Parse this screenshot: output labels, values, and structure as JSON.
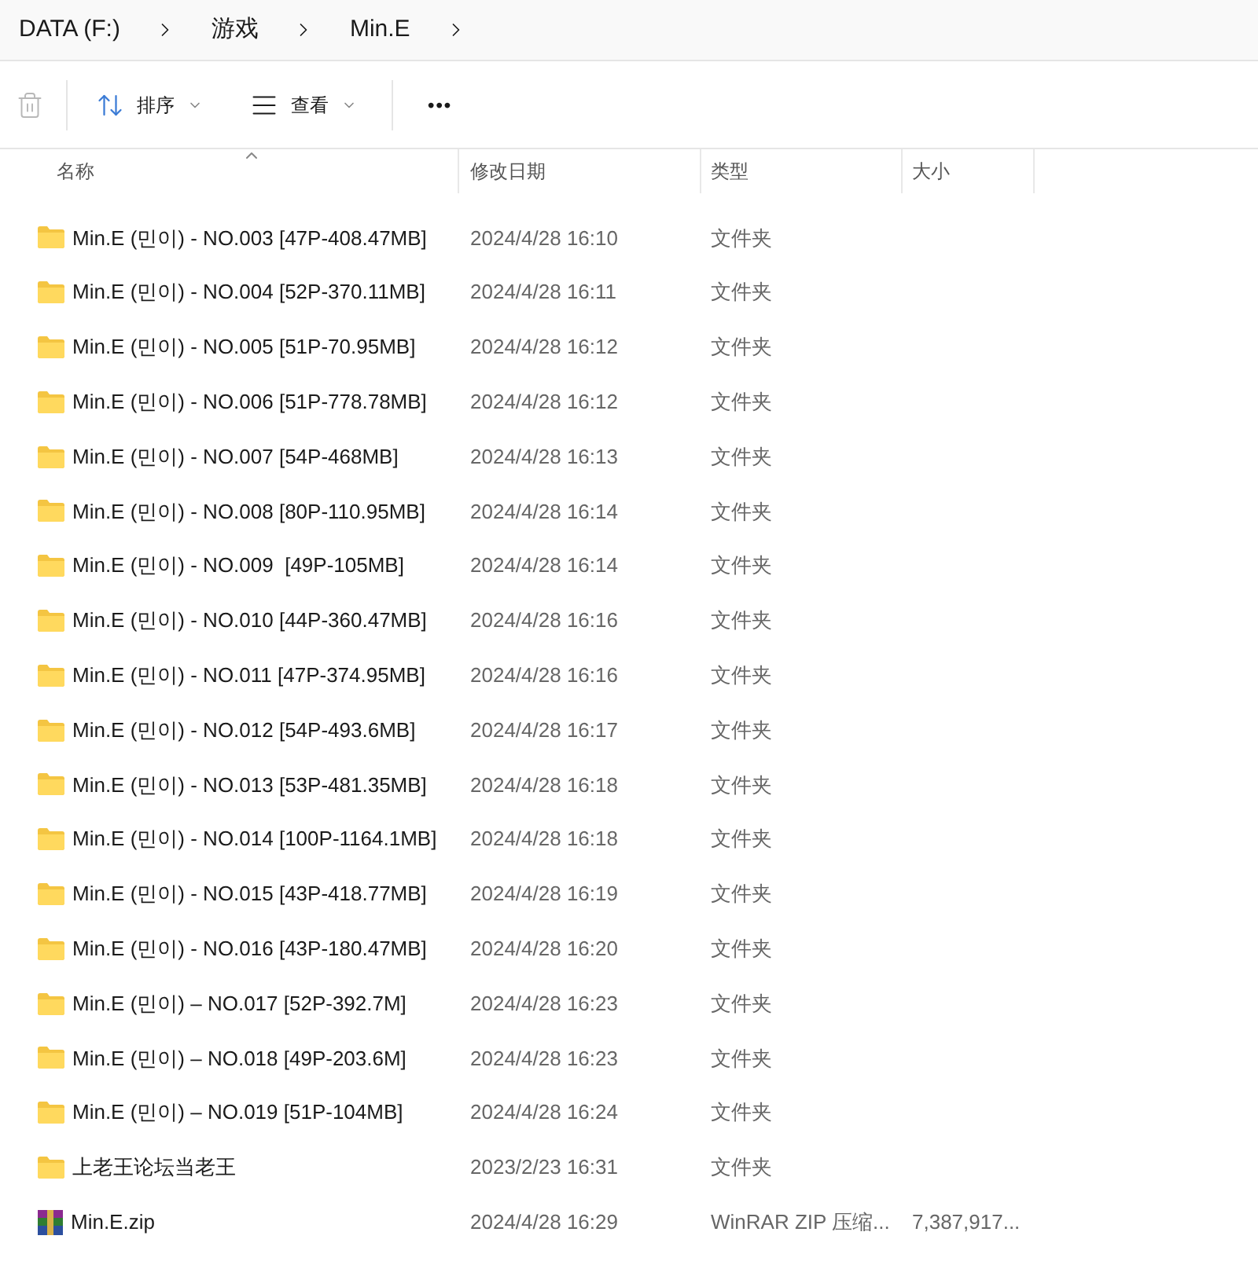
{
  "breadcrumb": [
    "DATA (F:)",
    "游戏",
    "Min.E"
  ],
  "toolbar": {
    "sort": "排序",
    "view": "查看",
    "more": "•••"
  },
  "table": {
    "columns": [
      "名称",
      "修改日期",
      "类型",
      "大小"
    ],
    "rows": [
      {
        "kind": "folder",
        "name": "Min.E (민이) - NO.003 [47P-408.47MB]",
        "date": "2024/4/28 16:10",
        "type": "文件夹"
      },
      {
        "kind": "folder",
        "name": "Min.E (민이) - NO.004 [52P-370.11MB]",
        "date": "2024/4/28 16:11",
        "type": "文件夹"
      },
      {
        "kind": "folder",
        "name": "Min.E (민이) - NO.005 [51P-70.95MB]",
        "date": "2024/4/28 16:12",
        "type": "文件夹"
      },
      {
        "kind": "folder",
        "name": "Min.E (민이) - NO.006 [51P-778.78MB]",
        "date": "2024/4/28 16:12",
        "type": "文件夹"
      },
      {
        "kind": "folder",
        "name": "Min.E (민이) - NO.007 [54P-468MB]",
        "date": "2024/4/28 16:13",
        "type": "文件夹"
      },
      {
        "kind": "folder",
        "name": "Min.E (민이) - NO.008 [80P-110.95MB]",
        "date": "2024/4/28 16:14",
        "type": "文件夹"
      },
      {
        "kind": "folder",
        "name": "Min.E (민이) - NO.009  [49P-105MB]",
        "date": "2024/4/28 16:14",
        "type": "文件夹"
      },
      {
        "kind": "folder",
        "name": "Min.E (민이) - NO.010 [44P-360.47MB]",
        "date": "2024/4/28 16:16",
        "type": "文件夹"
      },
      {
        "kind": "folder",
        "name": "Min.E (민이) - NO.011 [47P-374.95MB]",
        "date": "2024/4/28 16:16",
        "type": "文件夹"
      },
      {
        "kind": "folder",
        "name": "Min.E (민이) - NO.012 [54P-493.6MB]",
        "date": "2024/4/28 16:17",
        "type": "文件夹"
      },
      {
        "kind": "folder",
        "name": "Min.E (민이) - NO.013 [53P-481.35MB]",
        "date": "2024/4/28 16:18",
        "type": "文件夹"
      },
      {
        "kind": "folder",
        "name": "Min.E (민이) - NO.014 [100P-1164.1MB]",
        "date": "2024/4/28 16:18",
        "type": "文件夹"
      },
      {
        "kind": "folder",
        "name": "Min.E (민이) - NO.015 [43P-418.77MB]",
        "date": "2024/4/28 16:19",
        "type": "文件夹"
      },
      {
        "kind": "folder",
        "name": "Min.E (민이) - NO.016 [43P-180.47MB]",
        "date": "2024/4/28 16:20",
        "type": "文件夹"
      },
      {
        "kind": "folder",
        "name": "Min.E (민이) – NO.017 [52P-392.7M]",
        "date": "2024/4/28 16:23",
        "type": "文件夹"
      },
      {
        "kind": "folder",
        "name": "Min.E (민이) – NO.018 [49P-203.6M]",
        "date": "2024/4/28 16:23",
        "type": "文件夹"
      },
      {
        "kind": "folder",
        "name": "Min.E (민이) – NO.019 [51P-104MB]",
        "date": "2024/4/28 16:24",
        "type": "文件夹"
      },
      {
        "kind": "folder",
        "name": "上老王论坛当老王",
        "date": "2023/2/23 16:31",
        "type": "文件夹"
      },
      {
        "kind": "archive",
        "name": "Min.E.zip",
        "date": "2024/4/28 16:29",
        "type": "WinRAR ZIP 压缩...",
        "size": "7,387,917..."
      }
    ]
  }
}
